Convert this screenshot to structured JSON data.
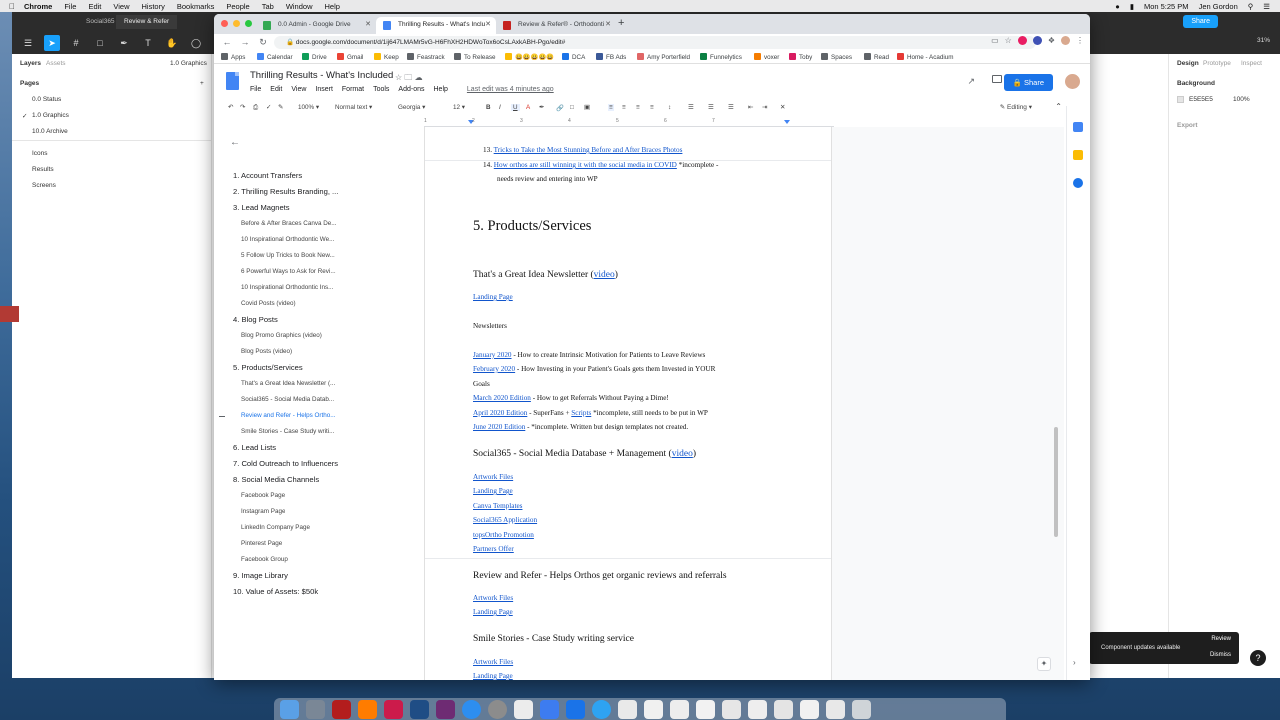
{
  "menubar": {
    "app": "Chrome",
    "items": [
      "File",
      "Edit",
      "View",
      "History",
      "Bookmarks",
      "People",
      "Tab",
      "Window",
      "Help"
    ],
    "datetime": "Mon 5:25 PM",
    "user": "Jen Gordon"
  },
  "figma": {
    "tabs": [
      "Social365",
      "Review & Refer"
    ],
    "share": "Share",
    "zoom": "31%",
    "left": {
      "tab_layers": "Layers",
      "tab_assets": "Assets",
      "page_select": "1.0 Graphics",
      "pages_label": "Pages",
      "pages": [
        "0.0 Status",
        "1.0 Graphics",
        "10.0 Archive"
      ],
      "layers": [
        "Icons",
        "Results",
        "Screens"
      ]
    },
    "right": {
      "tabs": [
        "Design",
        "Prototype",
        "Inspect"
      ],
      "background_label": "Background",
      "color": "E5E5E5",
      "opacity": "100%",
      "export": "Export"
    },
    "toast": {
      "message": "Component updates available",
      "review": "Review",
      "dismiss": "Dismiss"
    },
    "help": "?"
  },
  "chrome": {
    "tabs": [
      {
        "title": "0.0 Admin - Google Drive",
        "color": "#34a853"
      },
      {
        "title": "Thrilling Results - What's Inclu",
        "color": "#4285f4"
      },
      {
        "title": "Review & Refer® - Orthodonti",
        "color": "#c5221f"
      }
    ],
    "url": "docs.google.com/document/d/1ij647LMAMr5vG-H6FhXH2HDWoTox6oCsLAxkABH-Pgo/edit#",
    "bookmarks": [
      {
        "label": "Apps",
        "color": "#5f6368"
      },
      {
        "label": "Calendar",
        "color": "#4285f4"
      },
      {
        "label": "Drive",
        "color": "#0f9d58"
      },
      {
        "label": "Gmail",
        "color": "#ea4335"
      },
      {
        "label": "Keep",
        "color": "#fbbc04"
      },
      {
        "label": "Feastrack",
        "color": "#5f6368"
      },
      {
        "label": "To Release",
        "color": "#5f6368"
      },
      {
        "label": "😀😀😀😀😀",
        "color": "#fbbc04"
      },
      {
        "label": "DCA",
        "color": "#1a73e8"
      },
      {
        "label": "FB Ads",
        "color": "#3b5998"
      },
      {
        "label": "Amy Porterfield",
        "color": "#e06666"
      },
      {
        "label": "Funnelytics",
        "color": "#0b8043"
      },
      {
        "label": "voxer",
        "color": "#f57c00"
      },
      {
        "label": "Toby",
        "color": "#d81b60"
      },
      {
        "label": "Spaces",
        "color": "#5f6368"
      },
      {
        "label": "Read",
        "color": "#5f6368"
      },
      {
        "label": "Home - Acadium",
        "color": "#e53935"
      }
    ]
  },
  "docs": {
    "title": "Thrilling Results - What's Included",
    "menu": [
      "File",
      "Edit",
      "View",
      "Insert",
      "Format",
      "Tools",
      "Add-ons",
      "Help"
    ],
    "last_edit": "Last edit was 4 minutes ago",
    "share": "Share",
    "toolbar": {
      "zoom": "100%",
      "style": "Normal text",
      "font": "Georgia",
      "size": "12",
      "mode": "Editing"
    },
    "ruler": [
      "1",
      "2",
      "3",
      "4",
      "5",
      "6",
      "7"
    ],
    "outline": [
      {
        "text": "1. Account Transfers",
        "level": 1
      },
      {
        "text": "2. Thrilling Results Branding, ...",
        "level": 1
      },
      {
        "text": "3. Lead Magnets",
        "level": 1
      },
      {
        "text": "Before & After Braces Canva De...",
        "level": 2
      },
      {
        "text": "10 Inspirational Orthodontic We...",
        "level": 2
      },
      {
        "text": "5 Follow Up Tricks to Book New...",
        "level": 2
      },
      {
        "text": "6 Powerful Ways to Ask for Revi...",
        "level": 2
      },
      {
        "text": "10 Inspirational Orthodontic Ins...",
        "level": 2
      },
      {
        "text": "Covid Posts (video)",
        "level": 2
      },
      {
        "text": "4. Blog Posts",
        "level": 1
      },
      {
        "text": "Blog Promo Graphics (video)",
        "level": 2
      },
      {
        "text": "Blog Posts (video)",
        "level": 2
      },
      {
        "text": "5. Products/Services",
        "level": 1
      },
      {
        "text": "That's a Great Idea Newsletter (...",
        "level": 2
      },
      {
        "text": "Social365 - Social Media Datab...",
        "level": 2
      },
      {
        "text": "Review and Refer - Helps Ortho...",
        "level": 2,
        "active": true
      },
      {
        "text": "Smile Stories - Case Study writi...",
        "level": 2
      },
      {
        "text": "6. Lead Lists",
        "level": 1
      },
      {
        "text": "7. Cold Outreach to Influencers",
        "level": 1
      },
      {
        "text": "8. Social Media Channels",
        "level": 1
      },
      {
        "text": "Facebook Page",
        "level": 2
      },
      {
        "text": "Instagram Page",
        "level": 2
      },
      {
        "text": "LinkedIn Company Page",
        "level": 2
      },
      {
        "text": "Pinterest Page",
        "level": 2
      },
      {
        "text": "Facebook Group",
        "level": 2
      },
      {
        "text": "9. Image Library",
        "level": 1
      },
      {
        "text": "10. Value of Assets: $50k",
        "level": 1
      }
    ],
    "body": {
      "item13_num": "13.",
      "item13_link": "Tricks to Take the Most Stunning Before and After Braces Photos",
      "item14_num": "14.",
      "item14_link": "How orthos are still winning it with the social media in COVID",
      "item14_note": " *incomplete -",
      "item14_cont": "needs review and entering into WP",
      "section_title": "5. Products/Services",
      "newsletter_heading": "That's a Great Idea Newsletter (",
      "video_link": "video",
      "close_paren": ")",
      "landing_page": "Landing Page",
      "newsletters_label": "Newsletters",
      "jan_link": "January 2020",
      "jan_text": " - How to create Intrinsic Motivation for Patients to Leave Reviews",
      "feb_link": "February 2020",
      "feb_text": " - How Investing in your Patient's Goals gets them Invested in YOUR",
      "feb_cont": "Goals",
      "mar_link": "March 2020 Edition",
      "mar_text": " - How to get Referrals Without Paying a Dime!",
      "apr_link": "April 2020 Edition",
      "apr_text1": " - SuperFans + ",
      "apr_link2": "Scripts",
      "apr_text2": " *incomplete, still needs to be put in WP",
      "jun_link": "June 2020 Edition",
      "jun_text": " - *incomplete. Written but design templates not created.",
      "social_heading": "Social365 - Social Media Database + Management (",
      "social_links": [
        "Artwork Files",
        "Landing Page",
        "Canva Templates",
        "Social365 Application",
        "topsOrtho Promotion",
        "Partners Offer"
      ],
      "review_heading": "Review and Refer - Helps Orthos get organic reviews and referrals",
      "review_links": [
        "Artwork Files",
        "Landing Page"
      ],
      "smile_heading": "Smile Stories - Case Study writing service",
      "smile_links": [
        "Artwork Files",
        "Landing Page"
      ]
    }
  }
}
